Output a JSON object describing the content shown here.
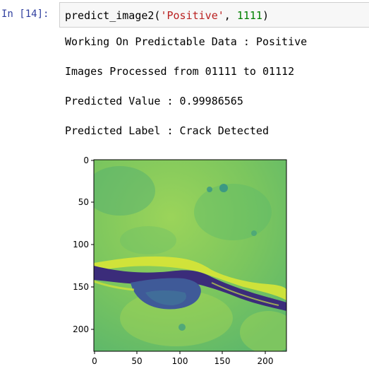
{
  "cell": {
    "prompt": "In [14]:",
    "code": {
      "func": "predict_image2(",
      "arg1": "'Positive'",
      "sep": ", ",
      "arg2": "1111",
      "close": ")"
    }
  },
  "output": {
    "lines": [
      "Working On Predictable Data : Positive",
      "Images Processed from 01111 to 01112",
      "Predicted Value : 0.99986565",
      "Predicted Label : Crack Detected"
    ]
  },
  "image_plot": {
    "x_ticks": [
      "0",
      "50",
      "100",
      "150",
      "200"
    ],
    "y_ticks": [
      "0",
      "50",
      "100",
      "150",
      "200"
    ],
    "colormap": "viridis",
    "colors": {
      "background": "#8fcf5a",
      "crack": "#3b2c7a",
      "edge": "#d8e636"
    }
  }
}
